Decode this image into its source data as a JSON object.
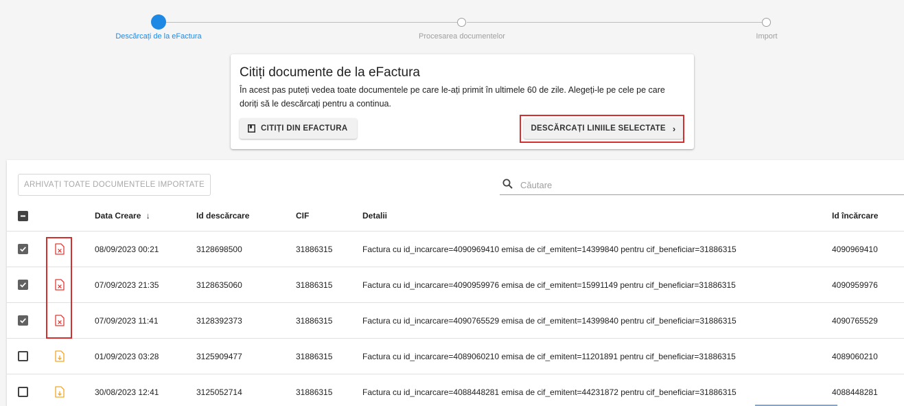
{
  "stepper": {
    "steps": [
      {
        "label": "Descărcați de la eFactura",
        "state": "active"
      },
      {
        "label": "Procesarea documentelor",
        "state": "pending"
      },
      {
        "label": "Import",
        "state": "pending"
      }
    ]
  },
  "card": {
    "title": "Citiți documente de la eFactura",
    "description": "În acest pas puteți vedea toate documentele pe care le-ați primit în ultimele 60 de zile. Alegeți-le pe cele pe care doriți să le descărcați pentru a continua.",
    "read_button_label": "CITIȚI DIN EFACTURA",
    "read_button_icon": "book-icon",
    "download_button_label": "DESCĂRCAȚI LINIILE SELECTATE",
    "download_button_icon": "chevron-right-icon"
  },
  "toolbar": {
    "archive_button_label": "ARHIVAȚI TOATE DOCUMENTELE IMPORTATE",
    "search_placeholder": "Căutare",
    "search_value": ""
  },
  "table": {
    "select_all_state": "indeterminate",
    "columns": [
      "Data Creare",
      "Id descărcare",
      "CIF",
      "Detalii",
      "Id încărcare"
    ],
    "sort_column": "Data Creare",
    "sort_direction": "desc",
    "rows": [
      {
        "checked": true,
        "status_icon": "file-error-icon",
        "date": "08/09/2023 00:21",
        "id_descarcare": "3128698500",
        "cif": "31886315",
        "detalii": "Factura cu id_incarcare=4090969410 emisa de cif_emitent=14399840 pentru cif_beneficiar=31886315",
        "id_incarcare": "4090969410"
      },
      {
        "checked": true,
        "status_icon": "file-error-icon",
        "date": "07/09/2023 21:35",
        "id_descarcare": "3128635060",
        "cif": "31886315",
        "detalii": "Factura cu id_incarcare=4090959976 emisa de cif_emitent=15991149 pentru cif_beneficiar=31886315",
        "id_incarcare": "4090959976"
      },
      {
        "checked": true,
        "status_icon": "file-error-icon",
        "date": "07/09/2023 11:41",
        "id_descarcare": "3128392373",
        "cif": "31886315",
        "detalii": "Factura cu id_incarcare=4090765529 emisa de cif_emitent=14399840 pentru cif_beneficiar=31886315",
        "id_incarcare": "4090765529"
      },
      {
        "checked": false,
        "status_icon": "file-download-icon",
        "date": "01/09/2023 03:28",
        "id_descarcare": "3125909477",
        "cif": "31886315",
        "detalii": "Factura cu id_incarcare=4089060210 emisa de cif_emitent=11201891 pentru cif_beneficiar=31886315",
        "id_incarcare": "4089060210"
      },
      {
        "checked": false,
        "status_icon": "file-download-icon",
        "date": "30/08/2023 12:41",
        "id_descarcare": "3125052714",
        "cif": "31886315",
        "detalii": "Factura cu id_incarcare=4088448281 emisa de cif_emitent=44231872 pentru cif_beneficiar=31886315",
        "id_incarcare": "4088448281"
      }
    ]
  },
  "colors": {
    "accent": "#1e88e5",
    "highlight": "#d32f2f",
    "error_icon": "#e53935",
    "download_icon": "#f5a623"
  }
}
